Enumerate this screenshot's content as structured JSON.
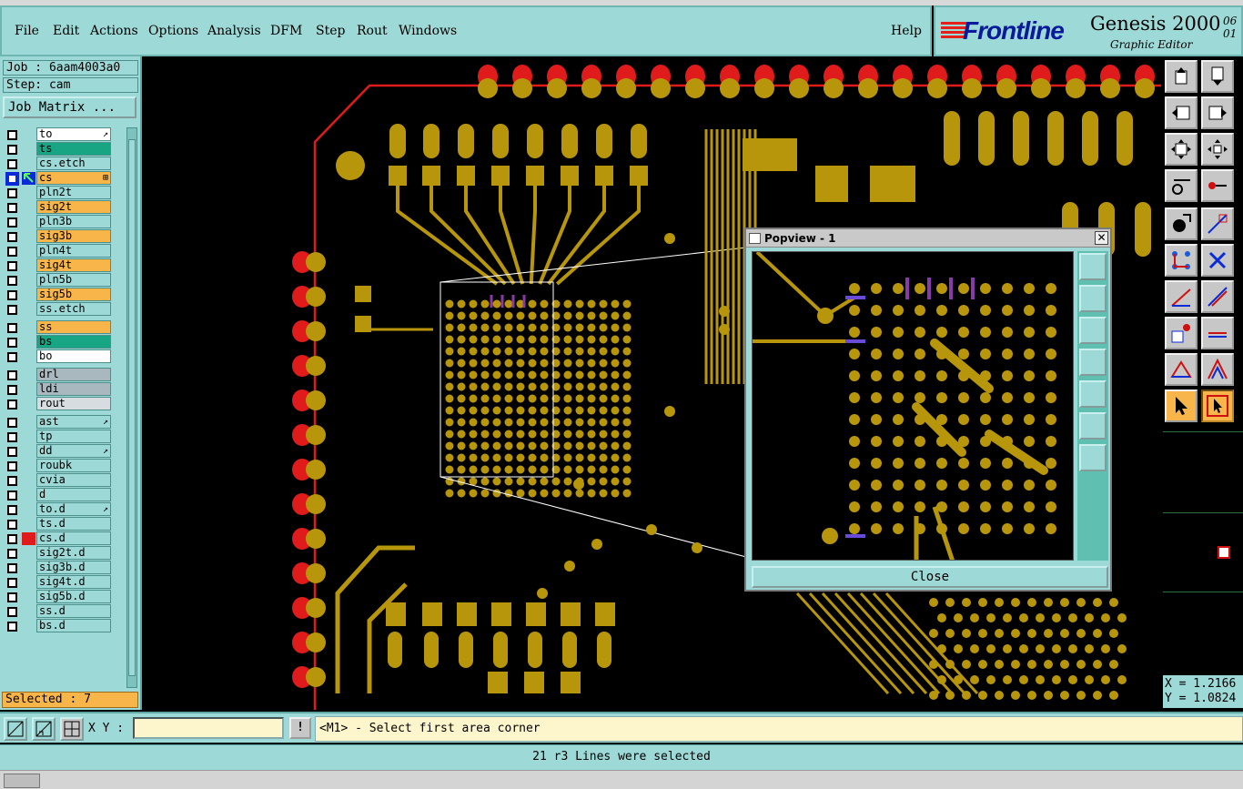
{
  "menu": {
    "items": [
      "File",
      "Edit",
      "Actions",
      "Options",
      "Analysis",
      "DFM",
      "Step",
      "Rout",
      "Windows"
    ],
    "help": "Help"
  },
  "brand": {
    "logo": "Frontline",
    "product": "Genesis 2000",
    "subtitle": "Graphic Editor",
    "version_line1": "06",
    "version_line2": "01"
  },
  "job": {
    "job_label": "Job : 6aam4003a0",
    "step_label": "Step: cam",
    "matrix_button": "Job Matrix ..."
  },
  "colors": {
    "board": "#000000",
    "copper": "#b8960c",
    "outline": "#e01b1b",
    "panel": "#9dd9d6",
    "layer_orange": "#f8b54a",
    "layer_green": "#17a584",
    "layer_white": "#ffffff",
    "layer_gray": "#a9b8be"
  },
  "layers": [
    {
      "name": "to",
      "color": "white",
      "arrow": "↗"
    },
    {
      "name": "ts",
      "color": "green",
      "arrow": ""
    },
    {
      "name": "cs.etch",
      "color": "panel",
      "arrow": ""
    },
    {
      "name": "cs",
      "color": "orange",
      "arrow": "⊞",
      "work": true
    },
    {
      "name": "pln2t",
      "color": "panel",
      "arrow": ""
    },
    {
      "name": "sig2t",
      "color": "orange",
      "arrow": ""
    },
    {
      "name": "pln3b",
      "color": "panel",
      "arrow": ""
    },
    {
      "name": "sig3b",
      "color": "orange",
      "arrow": ""
    },
    {
      "name": "pln4t",
      "color": "panel",
      "arrow": ""
    },
    {
      "name": "sig4t",
      "color": "orange",
      "arrow": ""
    },
    {
      "name": "pln5b",
      "color": "panel",
      "arrow": ""
    },
    {
      "name": "sig5b",
      "color": "orange",
      "arrow": ""
    },
    {
      "name": "ss.etch",
      "color": "panel",
      "arrow": ""
    },
    {
      "name": "ss",
      "color": "orange",
      "arrow": ""
    },
    {
      "name": "bs",
      "color": "green",
      "arrow": ""
    },
    {
      "name": "bo",
      "color": "white",
      "arrow": ""
    },
    {
      "name": "drl",
      "color": "gray",
      "arrow": ""
    },
    {
      "name": "ldi",
      "color": "gray",
      "arrow": ""
    },
    {
      "name": "rout",
      "color": "lightgray",
      "arrow": ""
    },
    {
      "name": "ast",
      "color": "panel",
      "arrow": "↗"
    },
    {
      "name": "tp",
      "color": "panel",
      "arrow": ""
    },
    {
      "name": "dd",
      "color": "panel",
      "arrow": "↗"
    },
    {
      "name": "roubk",
      "color": "panel",
      "arrow": ""
    },
    {
      "name": "cvia",
      "color": "panel",
      "arrow": ""
    },
    {
      "name": "d",
      "color": "panel",
      "arrow": ""
    },
    {
      "name": "to.d",
      "color": "panel",
      "arrow": "↗"
    },
    {
      "name": "ts.d",
      "color": "panel",
      "arrow": ""
    },
    {
      "name": "cs.d",
      "color": "panel",
      "arrow": "",
      "red": true
    },
    {
      "name": "sig2t.d",
      "color": "panel",
      "arrow": ""
    },
    {
      "name": "sig3b.d",
      "color": "panel",
      "arrow": ""
    },
    {
      "name": "sig4t.d",
      "color": "panel",
      "arrow": ""
    },
    {
      "name": "sig5b.d",
      "color": "panel",
      "arrow": ""
    },
    {
      "name": "ss.d",
      "color": "panel",
      "arrow": ""
    },
    {
      "name": "bs.d",
      "color": "panel",
      "arrow": ""
    }
  ],
  "selected_label": "Selected : 7",
  "popview": {
    "title": "Popview - 1",
    "close_label": "Close"
  },
  "coords": {
    "x": "X = 1.2166",
    "y": "Y = 1.0824"
  },
  "command": {
    "xy_label": "X Y :",
    "xy_value": "",
    "prompt": "<M1> - Select first area corner"
  },
  "status": "21 r3 Lines were selected"
}
